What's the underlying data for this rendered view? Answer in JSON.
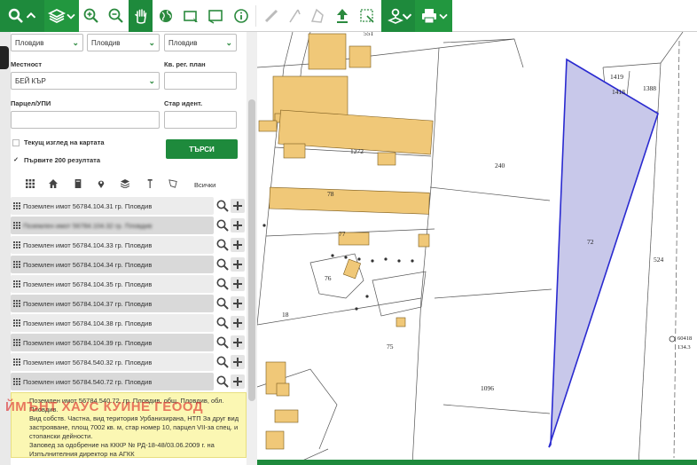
{
  "toolbar": {
    "tools": [
      {
        "icon": "search-icon"
      },
      {
        "icon": "layers-icon"
      },
      {
        "icon": "zoom-in-icon"
      },
      {
        "icon": "zoom-out-icon"
      },
      {
        "icon": "hand-pan-icon"
      },
      {
        "icon": "globe-icon"
      },
      {
        "icon": "select-rectangle-icon"
      },
      {
        "icon": "select-area-icon"
      },
      {
        "icon": "info-icon"
      },
      {
        "icon": "ruler-icon"
      },
      {
        "icon": "measure-area-icon"
      },
      {
        "icon": "upload-icon"
      },
      {
        "icon": "clear-selection-icon"
      },
      {
        "icon": "location-layers-icon"
      },
      {
        "icon": "print-icon"
      }
    ],
    "accent": "#1e8a3c"
  },
  "search_form": {
    "region_value": "Пловдив",
    "municipality_value": "Пловдив",
    "settlement_value": "Пловдив",
    "locality_label": "Местност",
    "locality_value": "БЕЙ КЪР",
    "plan_region_label": "Кв. рег. план",
    "parcel_label": "Парцел/УПИ",
    "old_id_label": "Стар идент.",
    "current_view_label": "Текущ изглед на картата",
    "first_200_label": "Първите 200 резултата",
    "first_200_checked": true,
    "search_button": "ТЪРСИ"
  },
  "results": {
    "all_label": "Всички",
    "items": [
      {
        "text": "Поземлен имот 56784.104.31 гр. Пловдив",
        "blurred": false
      },
      {
        "text": "Поземлен имот 56784.104.32 гр. Пловдив",
        "blurred": true
      },
      {
        "text": "Поземлен имот 56784.104.33 гр. Пловдив",
        "blurred": false
      },
      {
        "text": "Поземлен имот 56784.104.34 гр. Пловдив",
        "blurred": false
      },
      {
        "text": "Поземлен имот 56784.104.35 гр. Пловдив",
        "blurred": false
      },
      {
        "text": "Поземлен имот 56784.104.37 гр. Пловдив",
        "blurred": false
      },
      {
        "text": "Поземлен имот 56784.104.38 гр. Пловдив",
        "blurred": false
      },
      {
        "text": "Поземлен имот 56784.104.39 гр. Пловдив",
        "blurred": false
      },
      {
        "text": "Поземлен имот 56784.540.32 гр. Пловдив",
        "blurred": false
      },
      {
        "text": "Поземлен имот 56784.540.72 гр. Пловдив",
        "blurred": false
      }
    ]
  },
  "info": {
    "line1": "Поземлен имот 56784.540.72, гр. Пловдив, общ. Пловдив, обл. Пловдив.",
    "line2": "Вид собств. Частна, вид територия Урбанизирана, НТП За друг вид застрояване, площ 7002 кв. м, стар номер 10, парцел VII-за спец. и стопански дейности.",
    "line3": "Заповед за одобрение на КККР № РД-18-48/03.06.2009 г. на Изпълнителния директор на АГКК"
  },
  "watermark": "ЙМЪНТ ХАУС КУИНЕ ГЕООД",
  "map": {
    "labels": {
      "p551": "551",
      "p1419": "1419",
      "p1418": "1418",
      "p1388": "1388",
      "p1272": "1272",
      "p240": "240",
      "p72": "72",
      "p78": "78",
      "p77": "77",
      "p76": "76",
      "p18": "18",
      "p75": "75",
      "p1096": "1096",
      "p524": "524",
      "p60418": "60418",
      "p134": "134.3"
    },
    "selected_fill": "#c8c8ea",
    "selected_stroke": "#2a2ad0",
    "building_fill": "#f0c878"
  }
}
